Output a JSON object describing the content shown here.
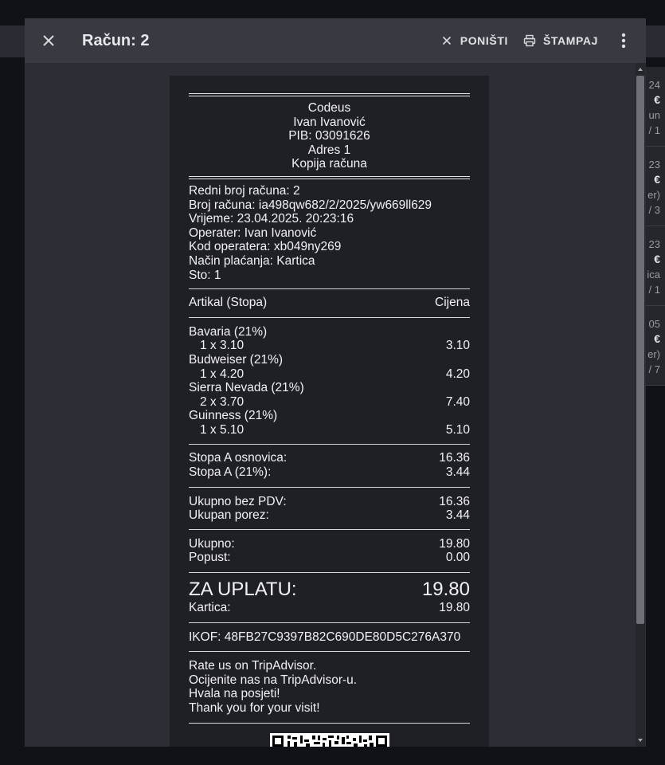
{
  "background": {
    "cards": [
      {
        "c1": "24",
        "c2": "€",
        "c3": "un",
        "c4": "/ 1"
      },
      {
        "c1": "23",
        "c2": "€",
        "c3": "er)",
        "c4": "/ 3"
      },
      {
        "c1": "23",
        "c2": "€",
        "c3": "ica",
        "c4": "/ 1"
      },
      {
        "c1": "05",
        "c2": "€",
        "c3": "er)",
        "c4": "/ 7"
      }
    ]
  },
  "modal": {
    "title": "Račun: 2",
    "cancel_label": "PONIŠTI",
    "print_label": "ŠTAMPAJ",
    "icons": {
      "close": "close-icon",
      "cancel": "x-icon",
      "print": "printer-icon",
      "more": "more-vert-icon"
    }
  },
  "receipt": {
    "header": [
      "Codeus",
      "Ivan Ivanović",
      "PIB: 03091626",
      "Adres 1",
      "Kopija računa"
    ],
    "info": [
      "Redni broj računa: 2",
      "Broj računa: ia498qw682/2/2025/yw669ll629",
      "Vrijeme: 23.04.2025. 20:23:16",
      "Operater: Ivan Ivanović",
      "Kod operatera: xb049ny269",
      "Način plaćanja: Kartica",
      "Sto: 1"
    ],
    "columns": {
      "item": "Artikal (Stopa)",
      "price": "Cijena"
    },
    "items": [
      {
        "name": "Bavaria (21%)",
        "qty": "1 x 3.10",
        "total": "3.10"
      },
      {
        "name": "Budweiser (21%)",
        "qty": "1 x 4.20",
        "total": "4.20"
      },
      {
        "name": "Sierra Nevada (21%)",
        "qty": "2 x 3.70",
        "total": "7.40"
      },
      {
        "name": "Guinness (21%)",
        "qty": "1 x 5.10",
        "total": "5.10"
      }
    ],
    "tax": [
      {
        "label": "Stopa A osnovica:",
        "value": "16.36"
      },
      {
        "label": "Stopa A (21%):",
        "value": "3.44"
      }
    ],
    "subtotal": [
      {
        "label": "Ukupno bez PDV:",
        "value": "16.36"
      },
      {
        "label": "Ukupan porez:",
        "value": "3.44"
      }
    ],
    "total": [
      {
        "label": "Ukupno:",
        "value": "19.80"
      },
      {
        "label": "Popust:",
        "value": "0.00"
      }
    ],
    "pay": {
      "label": "ZA UPLATU:",
      "value": "19.80"
    },
    "card": {
      "label": "Kartica:",
      "value": "19.80"
    },
    "ikof": "IKOF: 48FB27C9397B82C690DE80D5C276A370",
    "footer": [
      "Rate us on TripAdvisor.",
      "Ocijenite nas na TripAdvisor-u.",
      "Hvala na posjeti!",
      "Thank you for your visit!"
    ],
    "qr_icon": "qr-code-icon"
  }
}
